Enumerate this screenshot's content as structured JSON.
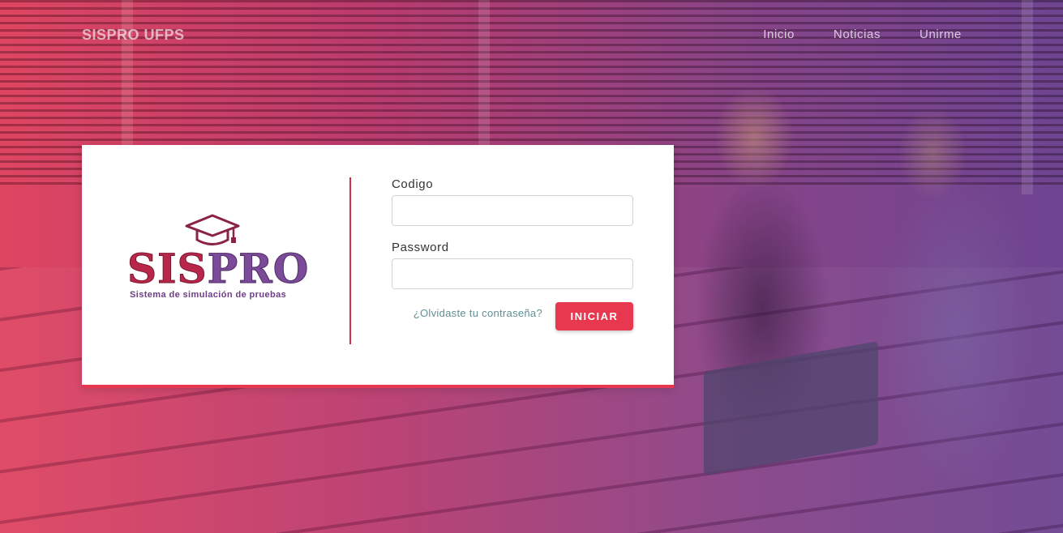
{
  "nav": {
    "brand": "SISPRO UFPS",
    "links": [
      "Inicio",
      "Noticias",
      "Unirme"
    ]
  },
  "logo": {
    "text_part1": "SIS",
    "text_part2": "PRO",
    "tagline": "Sistema de simulación de pruebas",
    "icon": "graduation-cap-icon"
  },
  "form": {
    "codigo_label": "Codigo",
    "codigo_value": "",
    "password_label": "Password",
    "password_value": "",
    "forgot_link": "¿Olvidaste tu contraseña?",
    "submit_label": "INICIAR"
  },
  "colors": {
    "accent": "#e8384f",
    "logo_red": "#b8264a",
    "logo_purple": "#7b4a98",
    "link": "#5f8f95"
  }
}
